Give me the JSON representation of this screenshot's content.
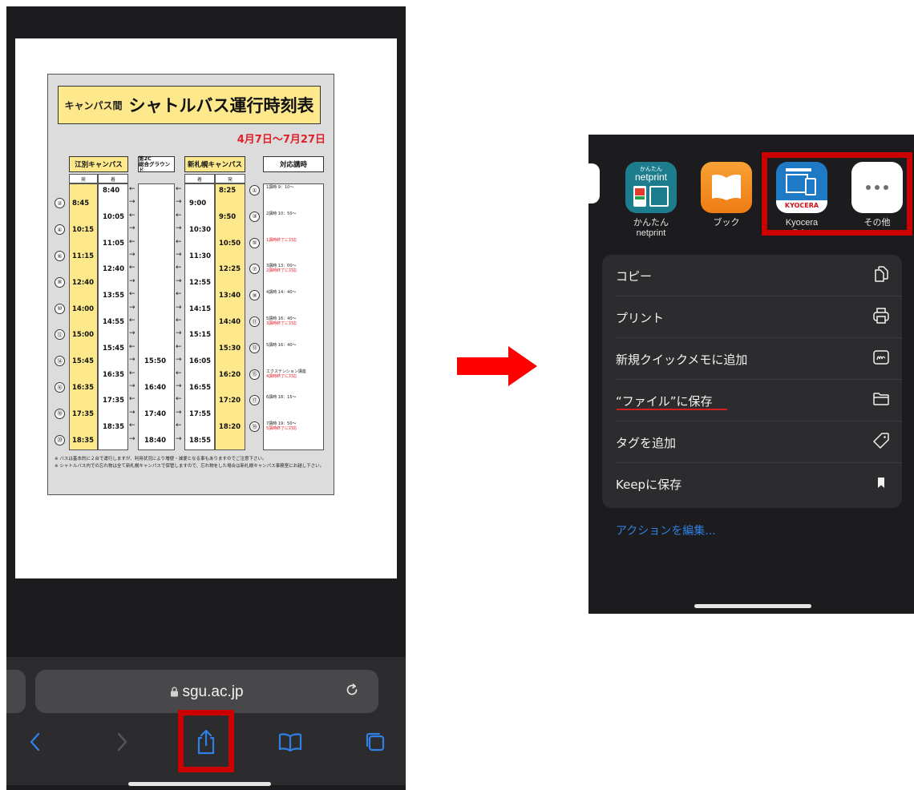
{
  "left": {
    "timetable": {
      "title_small": "キャンパス間",
      "title_main": "シャトルバス運行時刻表",
      "date_range": "4月7日～7月27日",
      "headers": {
        "ebetsu": "江別キャンパス",
        "ground": "第2C\n総合グラウンド",
        "shin": "新札幌キャンパス",
        "lecture": "対応講時"
      },
      "sub_labels": {
        "dep": "発",
        "arr": "着"
      },
      "ebetsu_dep": [
        "8:45",
        "10:15",
        "11:15",
        "12:40",
        "14:00",
        "15:00",
        "15:45",
        "16:35",
        "17:35",
        "18:35"
      ],
      "ebetsu_arr": [
        "8:40",
        "10:05",
        "11:05",
        "12:40",
        "13:55",
        "14:55",
        "15:45",
        "16:35",
        "17:35",
        "18:35"
      ],
      "ground": [
        "15:50",
        "16:40",
        "17:40",
        "18:40"
      ],
      "shin_arr": [
        "9:00",
        "10:30",
        "11:30",
        "12:55",
        "14:15",
        "15:15",
        "16:05",
        "16:55",
        "17:55",
        "18:55"
      ],
      "shin_dep": [
        "8:25",
        "9:50",
        "10:50",
        "12:25",
        "13:40",
        "14:40",
        "15:30",
        "16:20",
        "17:20",
        "18:20"
      ],
      "even_nums": [
        "②",
        "④",
        "⑥",
        "⑧",
        "⑩",
        "⑫",
        "⑭",
        "⑯",
        "⑱",
        "⑳"
      ],
      "odd_nums": [
        "①",
        "③",
        "⑤",
        "⑦",
        "⑨",
        "⑪",
        "⑬",
        "⑮",
        "⑰",
        "⑲"
      ],
      "lectures": [
        {
          "black": "1講時 9：10～",
          "red": ""
        },
        {
          "black": "2講時 10：50～",
          "red": ""
        },
        {
          "black": "",
          "red": "1講時終了に対応"
        },
        {
          "black": "3講時 13：00～",
          "red": "2講時終了に対応"
        },
        {
          "black": "4講時 14：40～",
          "red": ""
        },
        {
          "black": "5講時 16：40～",
          "red": "3講時終了に対応"
        },
        {
          "black": "5講時 16：40～",
          "red": ""
        },
        {
          "black": "エクステンション講座",
          "red": "4講時終了に対応"
        },
        {
          "black": "6講時 18：15～",
          "red": ""
        },
        {
          "black": "7講時 19：50～",
          "red": "5講時終了に対応"
        }
      ],
      "notes": [
        "※ バスは基本的に２台で運行しますが、利用状況により増便・減便となる事もありますのでご注意下さい。",
        "※ シャトルバス内での忘れ物は全て新札幌キャンパスで保管しますので、忘れ物をした場合は新札幌キャンパス事務室にお越し下さい。"
      ]
    },
    "address": "sgu.ac.jp",
    "icons": [
      "lock-icon",
      "reload-icon",
      "back-icon",
      "forward-icon",
      "share-icon",
      "bookmarks-icon",
      "tabs-icon"
    ]
  },
  "right": {
    "apps": [
      {
        "label": "かんたん\nnetprint",
        "icon": "netprint-icon",
        "icon_text_top": "かんたん",
        "icon_text": "netprint",
        "bg": "#1e7d8c"
      },
      {
        "label": "ブック",
        "icon": "books-icon",
        "bg": "#f28c1e"
      },
      {
        "label": "Kyocera Print",
        "icon": "kyocera-print-icon",
        "icon_text": "KYOCERA",
        "bg": "#1f7ac6"
      },
      {
        "label": "その他",
        "icon": "more-icon",
        "bg": "#ffffff"
      }
    ],
    "menu": [
      {
        "label": "コピー",
        "icon": "copy-icon"
      },
      {
        "label": "プリント",
        "icon": "print-icon"
      },
      {
        "label": "新規クイックメモに追加",
        "icon": "quick-note-icon"
      },
      {
        "label": "“ファイル”に保存",
        "icon": "folder-icon"
      },
      {
        "label": "タグを追加",
        "icon": "tag-icon"
      },
      {
        "label": "Keepに保存",
        "icon": "bookmark-icon"
      }
    ],
    "edit_actions": "アクションを編集..."
  },
  "colors": {
    "highlight": "#cc0000",
    "accent_blue": "#2f7fe4",
    "timetable_yellow": "#fde98b",
    "date_red": "#e0202a"
  }
}
